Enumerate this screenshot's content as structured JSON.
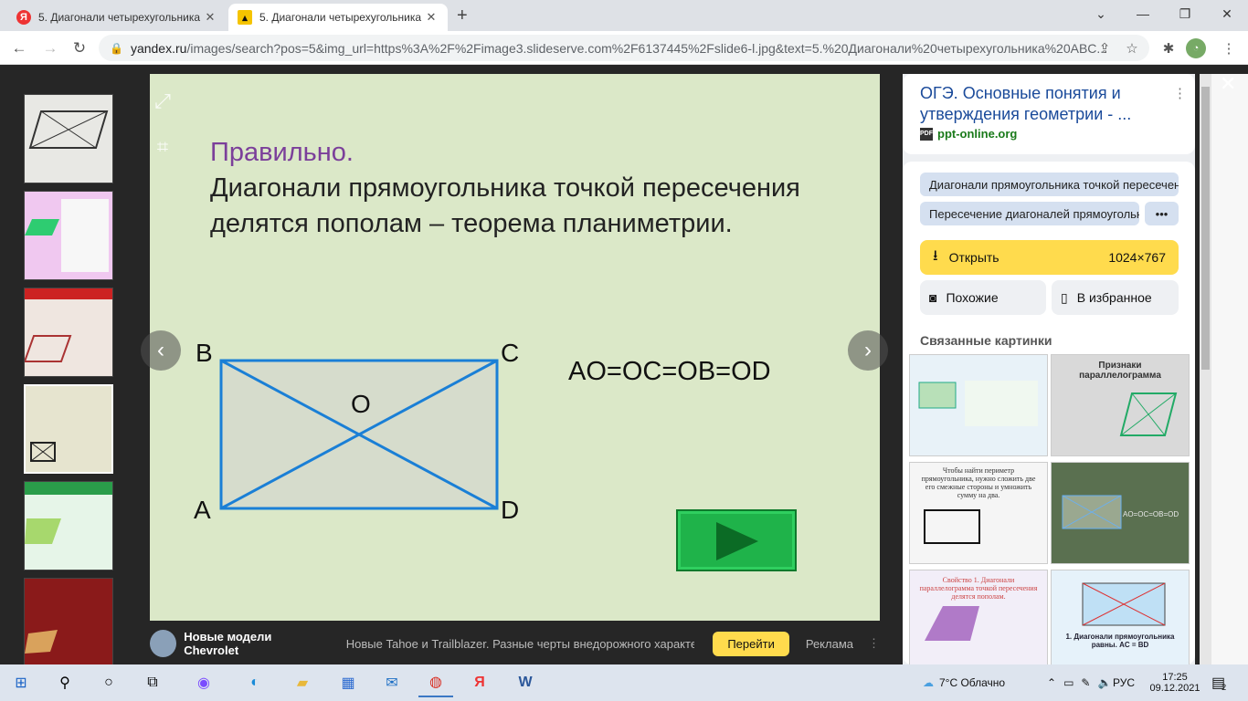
{
  "browser": {
    "tabs": [
      {
        "title": "5. Диагонали четырехугольника",
        "favicon": "yandex-icon",
        "active": false
      },
      {
        "title": "5. Диагонали четырехугольника",
        "favicon": "image-icon",
        "active": true
      }
    ],
    "new_tab": "+",
    "url_domain": "yandex.ru",
    "url_rest": "/images/search?pos=5&img_url=https%3A%2F%2Fimage3.slideserve.com%2F6137445%2Fslide6-l.jpg&text=5.%20Диагонали%20четырехугольника%20ABC..."
  },
  "slide": {
    "heading": "Правильно.",
    "body": "Диагонали прямоугольника точкой пересечения делятся пополам – теорема планиметрии.",
    "equation": "AO=OC=OB=OD",
    "vertices": {
      "a": "A",
      "b": "B",
      "c": "C",
      "d": "D",
      "o": "O"
    }
  },
  "ad": {
    "title": "Новые модели Chevrolet",
    "text": "Новые Tahoe и Trailblazer. Разные черты внедорожного характера",
    "button": "Перейти",
    "label": "Реклама",
    "more": "⋮"
  },
  "panel": {
    "title": "ОГЭ. Основные понятия и утверждения геометрии - ...",
    "source": "ppt-online.org",
    "pdf_badge": "PDF",
    "tags": [
      "Диагонали прямоугольника точкой пересечения",
      "Пересечение диагоналей прямоугольника"
    ],
    "more_tags": "•••",
    "open_label": "Открыть",
    "size": "1024×767",
    "similar": "Похожие",
    "favorite": "В избранное",
    "related_heading": "Связанные картинки",
    "related": [
      {
        "caption": "",
        "bg": "#e8f2f8"
      },
      {
        "caption": "Признаки параллелограмма",
        "bg": "#d9d9d9"
      },
      {
        "caption": "Чтобы найти периметр прямоугольника, нужно сложить две его смежные стороны и умножить сумму на два.",
        "bg": "#f5f5f5"
      },
      {
        "caption": "AO=OC=OB=OD",
        "bg": "#5a7050"
      },
      {
        "caption": "Свойство 1. Диагонали параллелограмма точкой пересечения делятся пополам.",
        "bg": "#f2eef8"
      },
      {
        "caption": "1. Диагонали прямоугольника равны. AC = BD",
        "bg": "#e6f2fa"
      }
    ]
  },
  "taskbar": {
    "weather": "7°C  Облачно",
    "lang": "РУС",
    "time": "17:25",
    "date": "09.12.2021",
    "notifications": "2"
  },
  "colors": {
    "accent": "#ffdb4d",
    "link": "#1a4a9a",
    "slide_bg": "#dbe8c8",
    "rect_line": "#1a7fd6",
    "heading": "#7b3f9a"
  }
}
